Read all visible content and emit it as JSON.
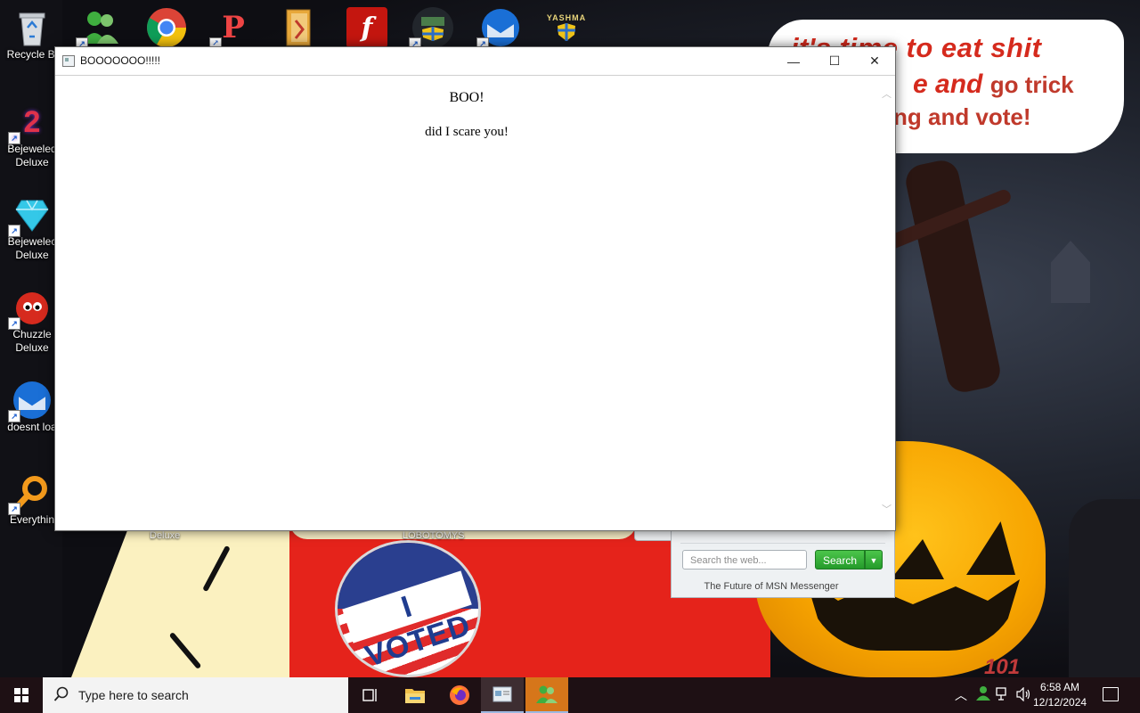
{
  "desktop": {
    "top_icons": [
      {
        "name": "recycle-bin-icon",
        "label": "Recycle Bi"
      },
      {
        "name": "msn-messenger-icon",
        "label": ""
      },
      {
        "name": "chrome-icon",
        "label": ""
      },
      {
        "name": "pinball-icon",
        "label": ""
      },
      {
        "name": "folder-icon",
        "label": ""
      },
      {
        "name": "flash-player-icon",
        "label": ""
      },
      {
        "name": "shield-app-icon",
        "label": ""
      },
      {
        "name": "thunderbird-icon",
        "label": ""
      },
      {
        "name": "yashma-icon",
        "label": "YASHMA"
      }
    ],
    "left_icons": [
      {
        "name": "bejeweled-2-icon",
        "label": "Bejeweled\nDeluxe"
      },
      {
        "name": "bejeweled-gem-icon",
        "label": "Bejewelec\nDeluxe"
      },
      {
        "name": "chuzzle-icon",
        "label": "Chuzzle\nDeluxe"
      },
      {
        "name": "thunderbird-desktop-icon",
        "label": "doesnt loa"
      },
      {
        "name": "everything-icon",
        "label": "Everythin"
      }
    ],
    "partial_labels": {
      "deluxe": "Deluxe",
      "lobotomys": "LOBOTOMYS"
    }
  },
  "wallpaper": {
    "bubble_line1": "it's time to eat shit",
    "bubble_line2_a": "e and",
    "bubble_line2_b": "go trick",
    "bubble_line3": "ng and vote!",
    "badge_text": "I VOTED",
    "graffiti": "101"
  },
  "window": {
    "title": "BOOOOOOO!!!!!",
    "controls": {
      "minimize": "—",
      "maximize": "☐",
      "close": "✕"
    },
    "content": {
      "heading": "BOO!",
      "text": "did I scare you!"
    }
  },
  "msn": {
    "search_placeholder": "Search the web...",
    "search_button": "Search",
    "footer": "The Future of MSN Messenger"
  },
  "taskbar": {
    "search_placeholder": "Type here to search",
    "apps": [
      "task-view",
      "file-explorer",
      "firefox",
      "app-window",
      "msn-messenger"
    ],
    "clock_time": "6:58 AM",
    "clock_date": "12/12/2024"
  },
  "colors": {
    "taskbar_bg": "#1e1014",
    "accent_red": "#d52a1d",
    "msn_green": "#249b2a"
  }
}
